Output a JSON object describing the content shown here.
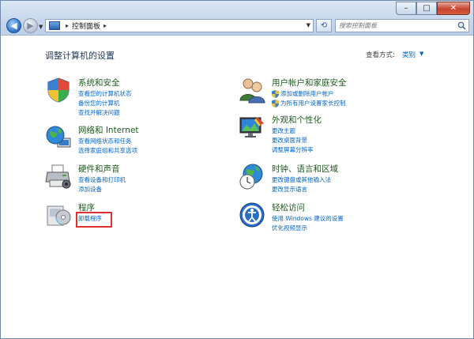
{
  "address": {
    "segments": [
      "控制面板"
    ]
  },
  "search": {
    "placeholder": "搜索控制面板"
  },
  "main": {
    "title": "调整计算机的设置",
    "view_by_label": "查看方式:",
    "view_by_value": "类别"
  },
  "categories": [
    {
      "title": "系统和安全",
      "links": [
        "查看您的计算机状态",
        "备份您的计算机",
        "查找并解决问题"
      ]
    },
    {
      "title": "网络和 Internet",
      "links": [
        "查看网络状态和任务",
        "选择家庭组和共享选项"
      ]
    },
    {
      "title": "硬件和声音",
      "links": [
        "查看设备和打印机",
        "添加设备"
      ]
    },
    {
      "title": "程序",
      "links": [
        "卸载程序"
      ]
    },
    {
      "title": "用户帐户和家庭安全",
      "links": [
        "添加或删除用户帐户",
        "为所有用户设置家长控制"
      ]
    },
    {
      "title": "外观和个性化",
      "links": [
        "更改主题",
        "更改桌面背景",
        "调整屏幕分辨率"
      ]
    },
    {
      "title": "时钟、语言和区域",
      "links": [
        "更改键盘或其他输入法",
        "更改显示语言"
      ]
    },
    {
      "title": "轻松访问",
      "links": [
        "使用 Windows 建议的设置",
        "优化视频显示"
      ]
    }
  ],
  "colors": {
    "link": "#0066cc",
    "category_title": "#1e5b1e",
    "highlight": "#e03030"
  }
}
